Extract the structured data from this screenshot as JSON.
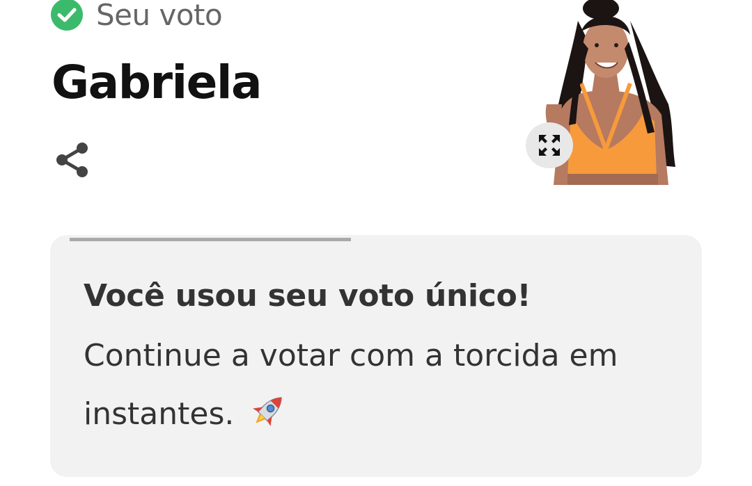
{
  "vote": {
    "status_label": "Seu voto",
    "status_icon": "check-circle-icon",
    "candidate_name": "Gabriela",
    "share_icon": "share-icon",
    "expand_icon": "expand-icon"
  },
  "card": {
    "title": "Você usou seu voto único!",
    "body": "Continue a votar com a torcida em instantes.",
    "emoji_icon": "rocket-icon",
    "progress": 0.47
  },
  "colors": {
    "check_green": "#3cba6c",
    "card_background": "#f2f2f2",
    "progress_bar": "#aaaaaa",
    "top_orange": "#f79a3b"
  }
}
